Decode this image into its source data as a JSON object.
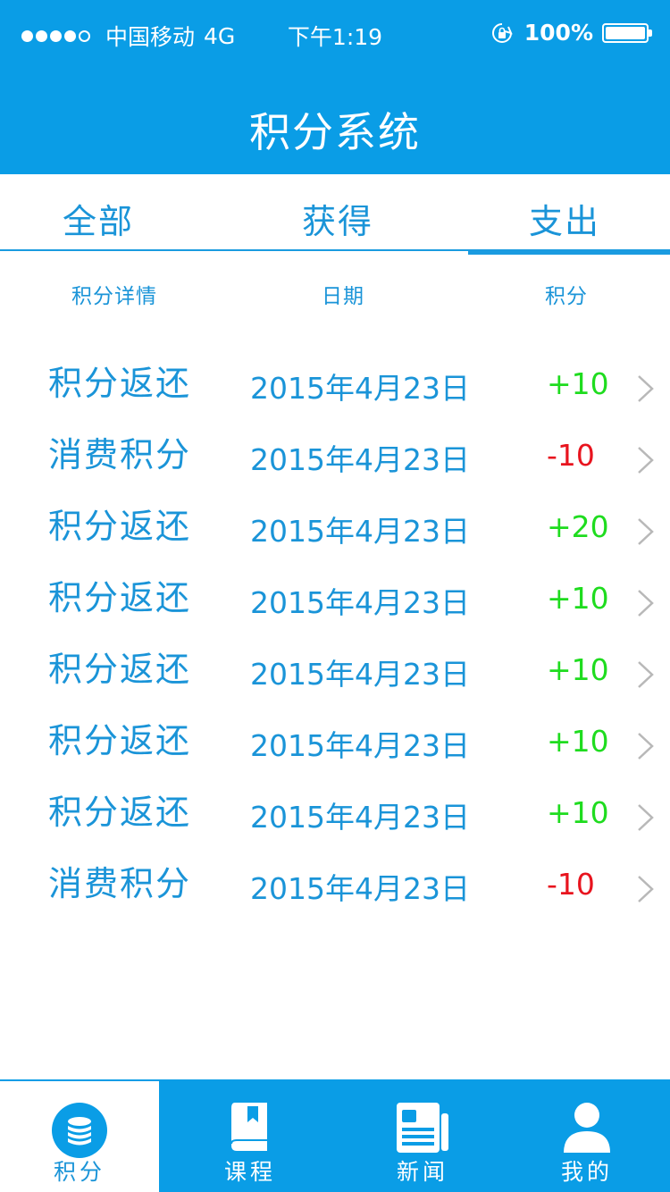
{
  "status_bar": {
    "carrier": "中国移动",
    "network": "4G",
    "time": "下午1:19",
    "battery": "100%"
  },
  "nav": {
    "title": "积分系统"
  },
  "tabs": [
    {
      "label": "全部"
    },
    {
      "label": "获得"
    },
    {
      "label": "支出",
      "active": true
    }
  ],
  "columns": {
    "detail": "积分详情",
    "date": "日期",
    "points": "积分"
  },
  "records": [
    {
      "name": "积分返还",
      "date": "2015年4月23日",
      "points": "+10"
    },
    {
      "name": "消费积分",
      "date": "2015年4月23日",
      "points": "-10"
    },
    {
      "name": "积分返还",
      "date": "2015年4月23日",
      "points": "+20"
    },
    {
      "name": "积分返还",
      "date": "2015年4月23日",
      "points": "+10"
    },
    {
      "name": "积分返还",
      "date": "2015年4月23日",
      "points": "+10"
    },
    {
      "name": "积分返还",
      "date": "2015年4月23日",
      "points": "+10"
    },
    {
      "name": "积分返还",
      "date": "2015年4月23日",
      "points": "+10"
    },
    {
      "name": "消费积分",
      "date": "2015年4月23日",
      "points": "-10"
    }
  ],
  "tabbar": {
    "points": "积分",
    "courses": "课程",
    "news": "新闻",
    "mine": "我的"
  },
  "colors": {
    "brand": "#0a9de6",
    "text_blue": "#1a94d8",
    "positive": "#1fdc1f",
    "negative": "#e8141e"
  }
}
